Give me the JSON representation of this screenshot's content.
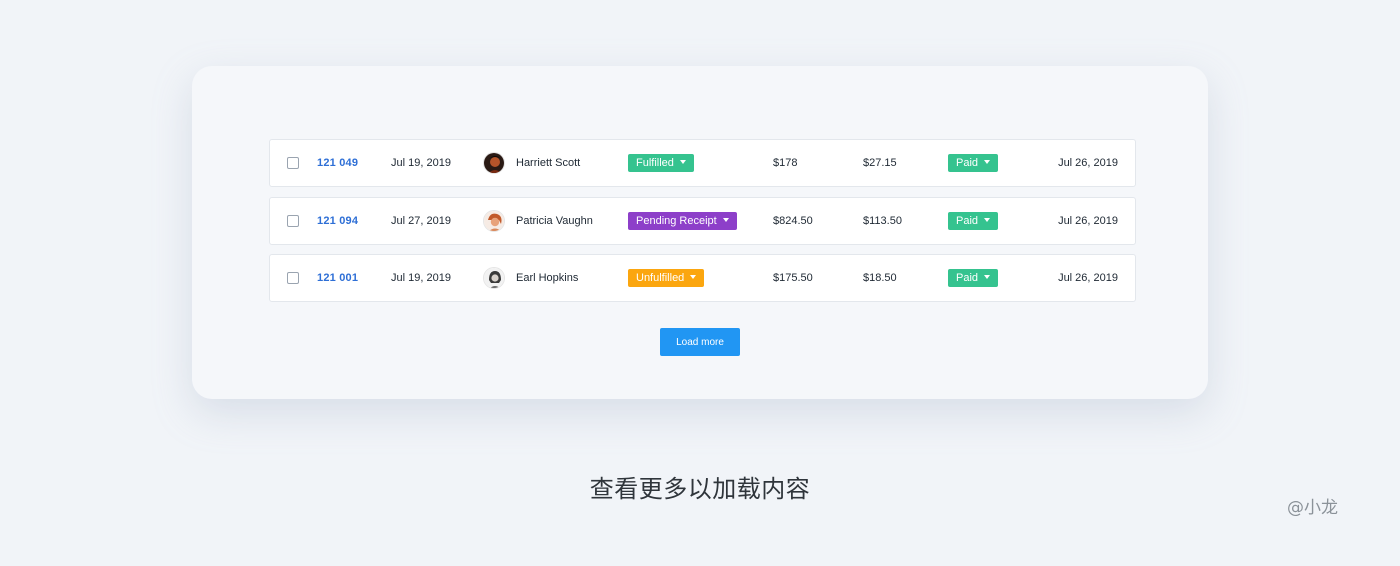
{
  "orders": [
    {
      "id": "121 049",
      "date": "Jul 19, 2019",
      "customer": "Harriett Scott",
      "avatar": "avatar-dark-portrait",
      "fulfillment": "Fulfilled",
      "fulfillment_color": "#35c38f",
      "total": "$178",
      "shipping": "$27.15",
      "payment": "Paid",
      "payment_color": "#35c38f",
      "due": "Jul 26, 2019"
    },
    {
      "id": "121 094",
      "date": "Jul 27, 2019",
      "customer": "Patricia Vaughn",
      "avatar": "avatar-warm-portrait",
      "fulfillment": "Pending Receipt",
      "fulfillment_color": "#8d3fc9",
      "total": "$824.50",
      "shipping": "$113.50",
      "payment": "Paid",
      "payment_color": "#35c38f",
      "due": "Jul 26, 2019"
    },
    {
      "id": "121 001",
      "date": "Jul 19, 2019",
      "customer": "Earl Hopkins",
      "avatar": "avatar-mono-portrait",
      "fulfillment": "Unfulfilled",
      "fulfillment_color": "#fba60f",
      "total": "$175.50",
      "shipping": "$18.50",
      "payment": "Paid",
      "payment_color": "#35c38f",
      "due": "Jul 26, 2019"
    }
  ],
  "load_more_label": "Load more",
  "load_more_color": "#2196f3",
  "caption": "查看更多以加载内容",
  "watermark": "@小龙"
}
